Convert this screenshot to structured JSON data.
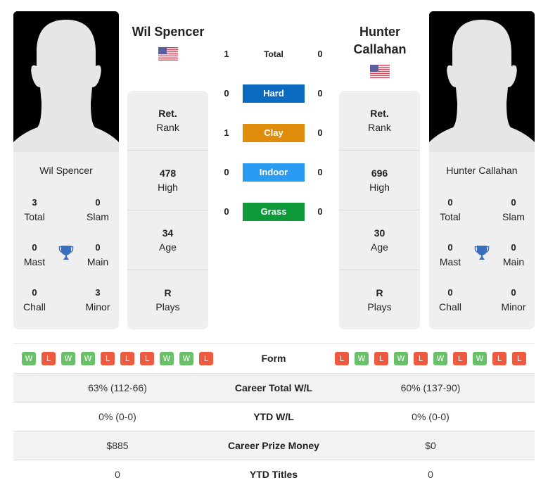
{
  "player_left": {
    "name": "Wil Spencer",
    "country_flag": "us-flag-icon",
    "titles": {
      "total": {
        "value": "3",
        "label": "Total"
      },
      "slam": {
        "value": "0",
        "label": "Slam"
      },
      "mast": {
        "value": "0",
        "label": "Mast"
      },
      "main": {
        "value": "0",
        "label": "Main"
      },
      "chall": {
        "value": "0",
        "label": "Chall"
      },
      "minor": {
        "value": "3",
        "label": "Minor"
      }
    },
    "rank": {
      "value": "Ret.",
      "label": "Rank"
    },
    "high": {
      "value": "478",
      "label": "High"
    },
    "age": {
      "value": "34",
      "label": "Age"
    },
    "plays": {
      "value": "R",
      "label": "Plays"
    },
    "form": [
      "W",
      "L",
      "W",
      "W",
      "L",
      "L",
      "L",
      "W",
      "W",
      "L"
    ]
  },
  "player_right": {
    "name": "Hunter Callahan",
    "name_line1": "Hunter",
    "name_line2": "Callahan",
    "country_flag": "us-flag-icon",
    "titles": {
      "total": {
        "value": "0",
        "label": "Total"
      },
      "slam": {
        "value": "0",
        "label": "Slam"
      },
      "mast": {
        "value": "0",
        "label": "Mast"
      },
      "main": {
        "value": "0",
        "label": "Main"
      },
      "chall": {
        "value": "0",
        "label": "Chall"
      },
      "minor": {
        "value": "0",
        "label": "Minor"
      }
    },
    "rank": {
      "value": "Ret.",
      "label": "Rank"
    },
    "high": {
      "value": "696",
      "label": "High"
    },
    "age": {
      "value": "30",
      "label": "Age"
    },
    "plays": {
      "value": "R",
      "label": "Plays"
    },
    "form": [
      "L",
      "W",
      "L",
      "W",
      "L",
      "W",
      "L",
      "W",
      "L",
      "L"
    ]
  },
  "h2h": [
    {
      "label": "Total",
      "left": "1",
      "right": "0",
      "color": ""
    },
    {
      "label": "Hard",
      "left": "0",
      "right": "0",
      "color": "#0a6bc0"
    },
    {
      "label": "Clay",
      "left": "1",
      "right": "0",
      "color": "#de8c0a"
    },
    {
      "label": "Indoor",
      "left": "0",
      "right": "0",
      "color": "#2a9bf2"
    },
    {
      "label": "Grass",
      "left": "0",
      "right": "0",
      "color": "#0e9a3a"
    }
  ],
  "form_label": "Form",
  "stats": [
    {
      "label": "Career Total W/L",
      "left": "63% (112-66)",
      "right": "60% (137-90)"
    },
    {
      "label": "YTD W/L",
      "left": "0% (0-0)",
      "right": "0% (0-0)"
    },
    {
      "label": "Career Prize Money",
      "left": "$885",
      "right": "$0"
    },
    {
      "label": "YTD Titles",
      "left": "0",
      "right": "0"
    }
  ],
  "colors": {
    "win": "#6abf69",
    "loss": "#ee5a3f",
    "trophy": "#3a6fbf"
  }
}
